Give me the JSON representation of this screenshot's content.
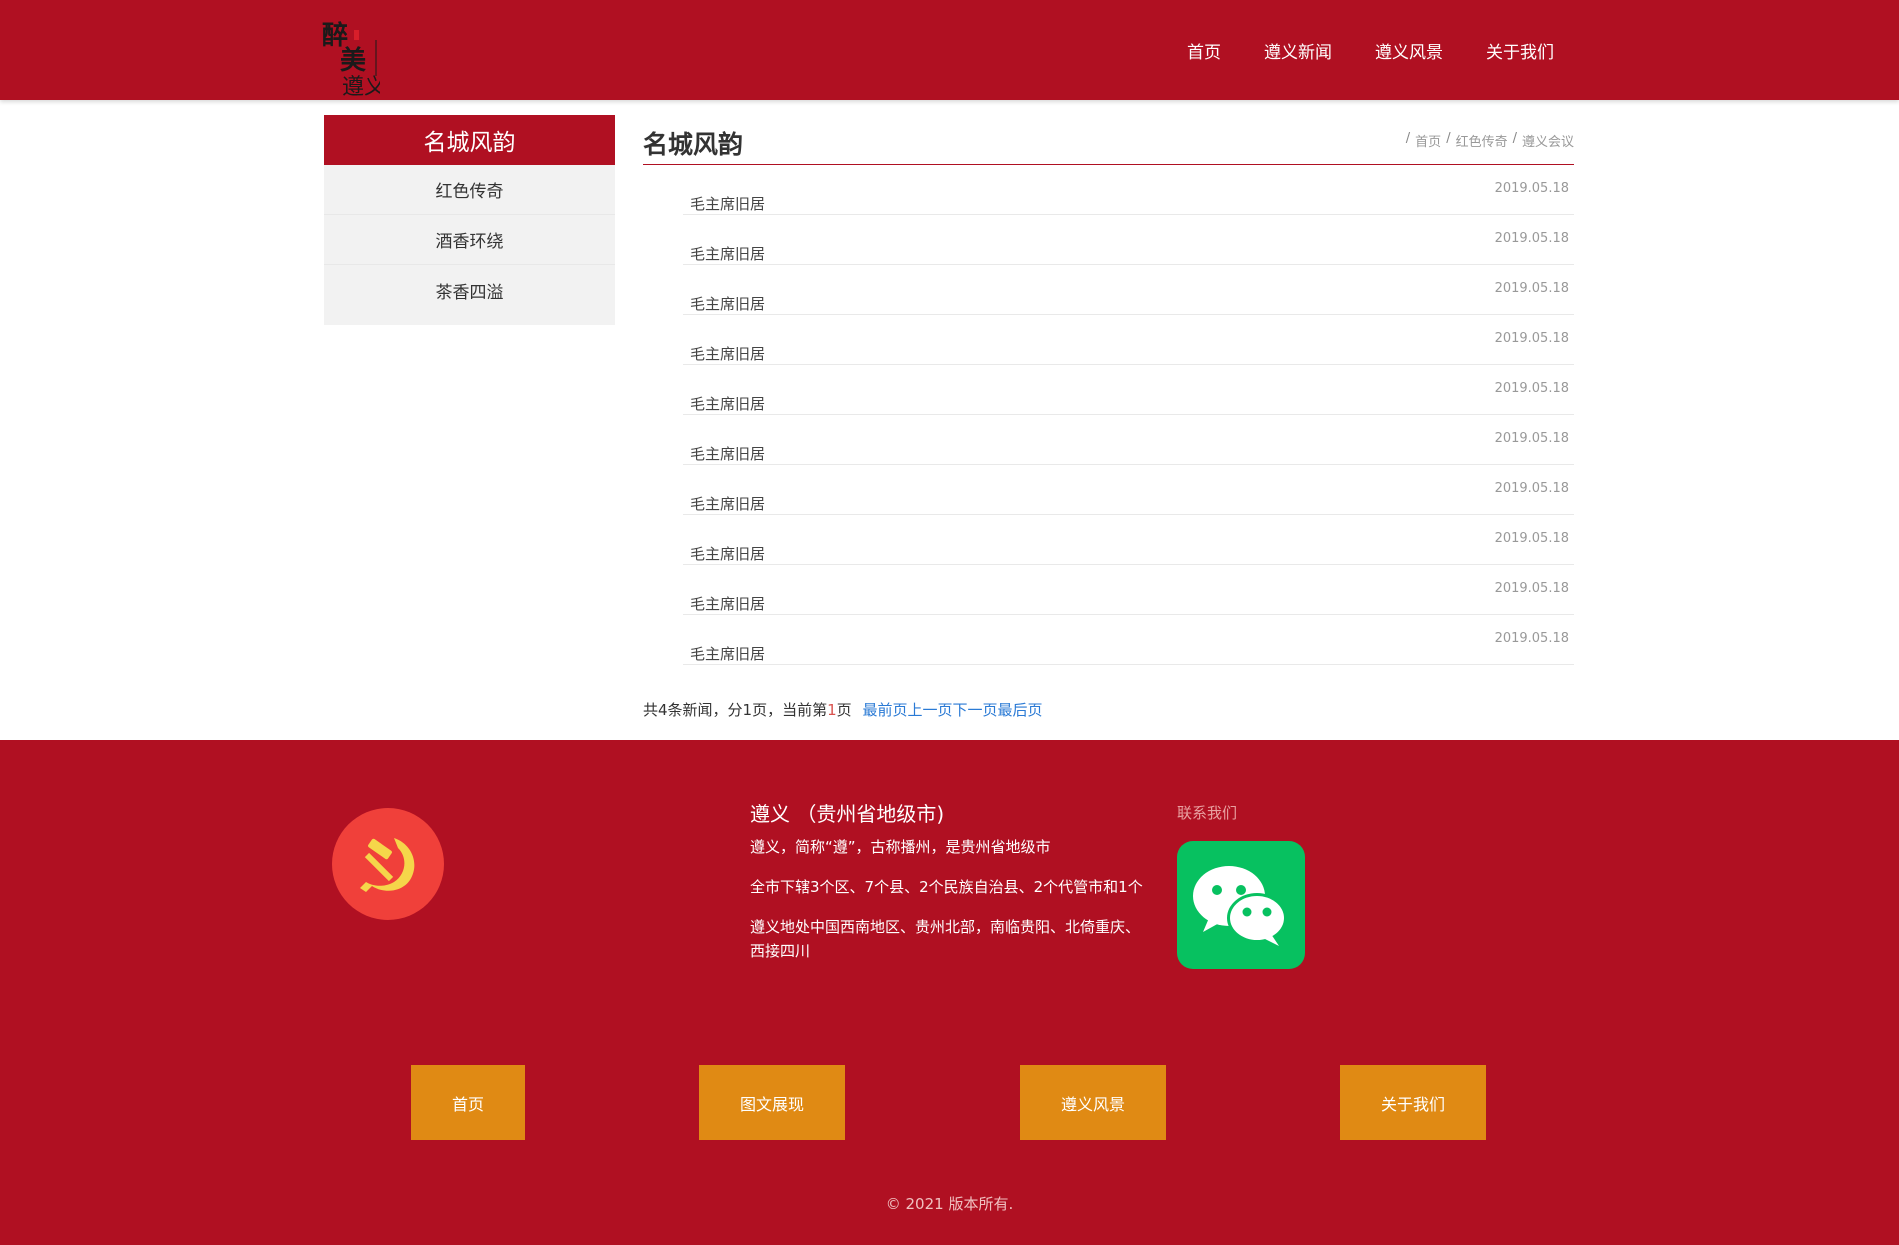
{
  "header": {
    "logo_alt": "醉美遵义",
    "nav": [
      "首页",
      "遵义新闻",
      "遵义风景",
      "关于我们"
    ]
  },
  "sidebar": {
    "title": "名城风韵",
    "items": [
      "红色传奇",
      "酒香环绕",
      "茶香四溢"
    ]
  },
  "main": {
    "title": "名城风韵",
    "breadcrumb": [
      "首页",
      "红色传奇",
      "遵义会议"
    ],
    "news": [
      {
        "title": "毛主席旧居",
        "date": "2019.05.18"
      },
      {
        "title": "毛主席旧居",
        "date": "2019.05.18"
      },
      {
        "title": "毛主席旧居",
        "date": "2019.05.18"
      },
      {
        "title": "毛主席旧居",
        "date": "2019.05.18"
      },
      {
        "title": "毛主席旧居",
        "date": "2019.05.18"
      },
      {
        "title": "毛主席旧居",
        "date": "2019.05.18"
      },
      {
        "title": "毛主席旧居",
        "date": "2019.05.18"
      },
      {
        "title": "毛主席旧居",
        "date": "2019.05.18"
      },
      {
        "title": "毛主席旧居",
        "date": "2019.05.18"
      },
      {
        "title": "毛主席旧居",
        "date": "2019.05.18"
      }
    ],
    "pager": {
      "summary_pre": "共4条新闻，分1页，当前第",
      "current": "1",
      "summary_post": "页",
      "first": "最前页",
      "prev": "上一页",
      "next": "下一页",
      "last": "最后页"
    }
  },
  "footer": {
    "info_title": "遵义 （贵州省地级市)",
    "info_paragraphs": [
      "遵义，简称“遵”，古称播州，是贵州省地级市",
      "全市下辖3个区、7个县、2个民族自治县、2个代管市和1个",
      "遵义地处中国西南地区、贵州北部，南临贵阳、北倚重庆、西接四川"
    ],
    "contact_label": "联系我们",
    "nav": [
      "首页",
      "图文展现",
      "遵义风景",
      "关于我们"
    ],
    "copyright": "© 2021 版本所有."
  },
  "colors": {
    "brand_red": "#b01022",
    "button_orange": "#e08a14",
    "link_blue": "#2a7ad5",
    "wechat_green": "#07c160"
  },
  "icons": {
    "emblem": "party-emblem-icon",
    "wechat": "wechat-icon"
  }
}
